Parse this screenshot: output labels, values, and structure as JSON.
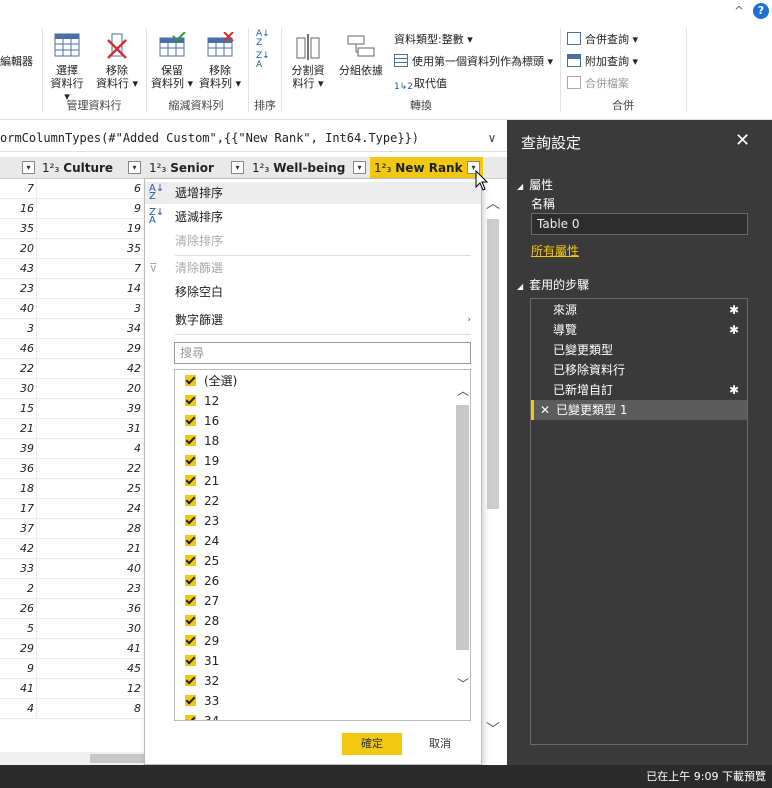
{
  "ribbon": {
    "collapse_glyph": "^",
    "help_glyph": "?",
    "partial_left_label": "編輯器",
    "select_columns": "選擇\n資料行 ▾",
    "remove_columns": "移除\n資料行 ▾",
    "group_manage_columns": "管理資料行",
    "keep_rows": "保留\n資料列 ▾",
    "remove_rows": "移除\n資料列 ▾",
    "group_reduce_rows": "縮減資料列",
    "group_sort": "排序",
    "split_column": "分割資\n料行 ▾",
    "group_by": "分組依據",
    "data_type": "資料類型:整數 ▾",
    "use_first_row": "使用第一個資料列作為標頭 ▾",
    "replace_values": "取代值",
    "group_transform": "轉換",
    "merge_queries": "合併查詢 ▾",
    "append_queries": "附加查詢 ▾",
    "combine_files": "合併檔案",
    "group_combine": "合併"
  },
  "formula": {
    "text": "ormColumnTypes(#\"Added Custom\",{{\"New Rank\", Int64.Type}})",
    "chevron": "∨"
  },
  "grid": {
    "type_prefix": "1²₃",
    "headers": [
      "Culture",
      "Senior",
      "Well-being",
      "New Rank"
    ],
    "rows": [
      [
        "7",
        "6"
      ],
      [
        "16",
        "9"
      ],
      [
        "35",
        "19"
      ],
      [
        "20",
        "35"
      ],
      [
        "43",
        "7"
      ],
      [
        "23",
        "14"
      ],
      [
        "40",
        "3"
      ],
      [
        "3",
        "34"
      ],
      [
        "46",
        "29"
      ],
      [
        "22",
        "42"
      ],
      [
        "30",
        "20"
      ],
      [
        "15",
        "39"
      ],
      [
        "21",
        "31"
      ],
      [
        "39",
        "4"
      ],
      [
        "36",
        "22"
      ],
      [
        "18",
        "25"
      ],
      [
        "17",
        "24"
      ],
      [
        "37",
        "28"
      ],
      [
        "42",
        "21"
      ],
      [
        "33",
        "40"
      ],
      [
        "2",
        "23"
      ],
      [
        "26",
        "36"
      ],
      [
        "5",
        "30"
      ],
      [
        "29",
        "41"
      ],
      [
        "9",
        "45"
      ],
      [
        "41",
        "12"
      ],
      [
        "4",
        "8"
      ]
    ]
  },
  "dropdown": {
    "sort_asc": "遞增排序",
    "sort_desc": "遞減排序",
    "clear_sort": "清除排序",
    "clear_filter": "清除篩選",
    "remove_empty": "移除空白",
    "number_filters": "數字篩選",
    "search_placeholder": "搜尋",
    "select_all": "(全選)",
    "values": [
      "12",
      "16",
      "18",
      "19",
      "21",
      "22",
      "23",
      "24",
      "25",
      "26",
      "27",
      "28",
      "29",
      "31",
      "32",
      "33",
      "34"
    ],
    "ok": "確定",
    "cancel": "取消"
  },
  "query_settings": {
    "title": "查詢設定",
    "properties_section": "屬性",
    "name_label": "名稱",
    "name_value": "Table 0",
    "all_properties": "所有屬性",
    "applied_steps_section": "套用的步驟",
    "steps": [
      {
        "label": "來源",
        "gear": true
      },
      {
        "label": "導覽",
        "gear": true
      },
      {
        "label": "已變更類型",
        "gear": false
      },
      {
        "label": "已移除資料行",
        "gear": false
      },
      {
        "label": "已新增自訂",
        "gear": true
      },
      {
        "label": "已變更類型 1",
        "gear": false,
        "selected": true
      }
    ]
  },
  "status": {
    "text": "已在上午 9:09 下載預覽"
  },
  "colors": {
    "accent": "#f2c811",
    "pane_bg": "#3a3a3a",
    "status_bg": "#2b2b2b"
  }
}
